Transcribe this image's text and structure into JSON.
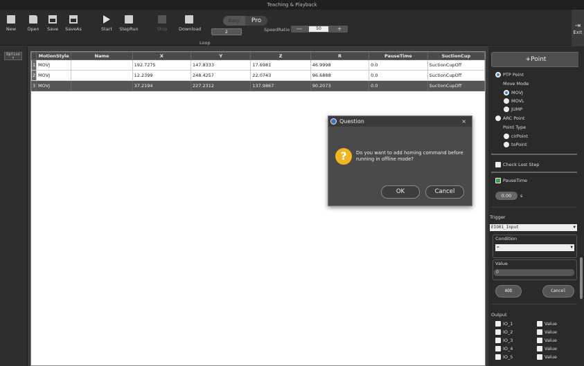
{
  "window": {
    "title": "Teaching & Playback"
  },
  "toolbar": {
    "new": "New",
    "open": "Open",
    "save": "Save",
    "saveas": "SaveAs",
    "start": "Start",
    "steprun": "StepRun",
    "stop": "Stop",
    "download": "Download",
    "loop_label": "Loop",
    "loop_value": "2",
    "mode_easy": "Easy",
    "mode_pro": "Pro",
    "speed_label": "SpeedRatio",
    "speed_minus": "—",
    "speed_value": "50",
    "speed_plus": "+",
    "exit": "Exit"
  },
  "left": {
    "option": "Option"
  },
  "table": {
    "headers": [
      "MotionStyle",
      "Name",
      "X",
      "Y",
      "Z",
      "R",
      "PauseTime",
      "SuctionCup"
    ],
    "rows": [
      {
        "num": "1",
        "style": "MOVJ",
        "name": "",
        "x": "192.7275",
        "y": "147.8333",
        "z": "17.6981",
        "r": "46.9998",
        "pause": "0.0",
        "suction": "SuctionCupOff"
      },
      {
        "num": "2",
        "style": "MOVJ",
        "name": "",
        "x": "12.2399",
        "y": "248.4257",
        "z": "22.0743",
        "r": "96.6888",
        "pause": "0.0",
        "suction": "SuctionCupOff"
      },
      {
        "num": "3",
        "style": "MOVJ",
        "name": "",
        "x": "37.2194",
        "y": "227.2312",
        "z": "137.9867",
        "r": "90.2073",
        "pause": "0.0",
        "suction": "SuctionCupOff"
      }
    ]
  },
  "dialog": {
    "title": "Question",
    "close": "×",
    "message": "Do you want to add homing command before running in offline mode?",
    "ok": "OK",
    "cancel": "Cancel"
  },
  "panel": {
    "add_point": "+Point",
    "ptp_point": "PTP Point",
    "move_mode": "Move Mode",
    "movj": "MOVJ",
    "movl": "MOVL",
    "jump": "JUMP",
    "arc_point": "ARC Point",
    "point_type": "Point Type",
    "cir_point": "cirPoint",
    "to_point": "toPoint",
    "check_lost_step": "Check Lost Step",
    "pause_time": "PauseTime",
    "pause_value": "0.00",
    "pause_unit": "s",
    "trigger": "Trigger",
    "trigger_select": "EIO01_Input",
    "condition": "Condition",
    "condition_select": "=",
    "value": "Value",
    "value_input": "0",
    "add": "ADD",
    "cancel": "Cancel",
    "output": "Output",
    "outputs": [
      {
        "io": "IO_1",
        "val": "Value"
      },
      {
        "io": "IO_2",
        "val": "Value"
      },
      {
        "io": "IO_3",
        "val": "Value"
      },
      {
        "io": "IO_4",
        "val": "Value"
      },
      {
        "io": "IO_5",
        "val": "Value"
      }
    ]
  }
}
